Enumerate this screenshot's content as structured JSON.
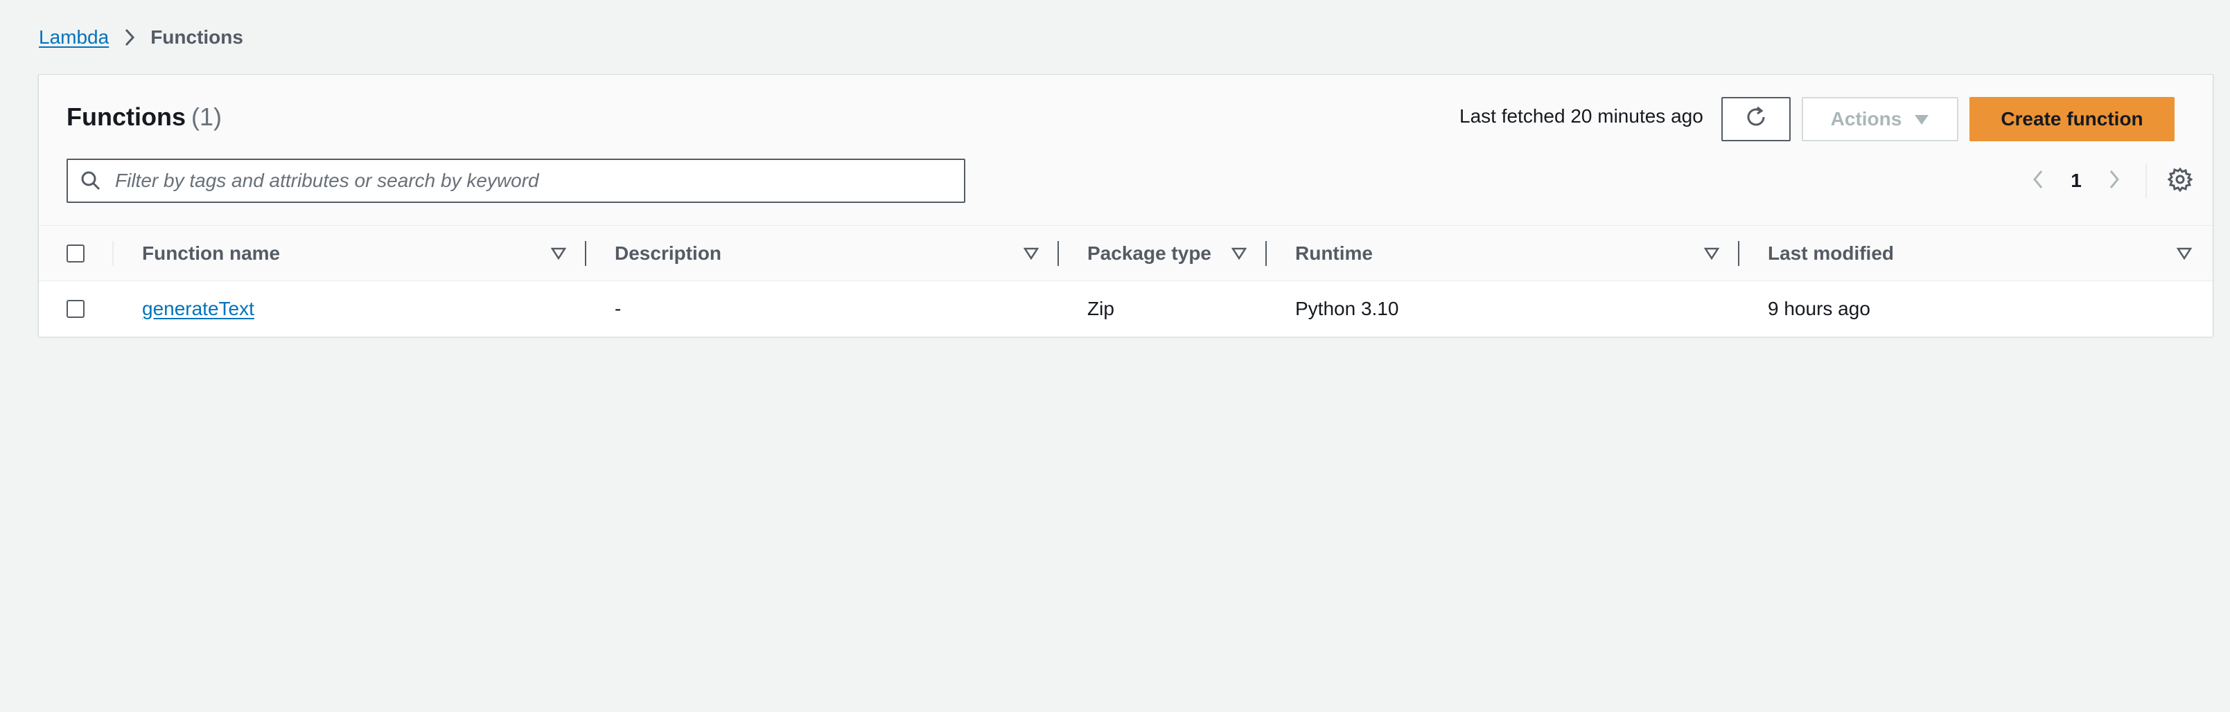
{
  "breadcrumb": {
    "root": "Lambda",
    "current": "Functions"
  },
  "panel": {
    "title": "Functions",
    "count": "(1)",
    "last_fetched": "Last fetched 20 minutes ago",
    "actions_label": "Actions",
    "create_label": "Create function"
  },
  "search": {
    "placeholder": "Filter by tags and attributes or search by keyword",
    "value": ""
  },
  "pagination": {
    "current_page": "1"
  },
  "table": {
    "columns": [
      {
        "label": "Function name"
      },
      {
        "label": "Description"
      },
      {
        "label": "Package type"
      },
      {
        "label": "Runtime"
      },
      {
        "label": "Last modified"
      }
    ],
    "rows": [
      {
        "function_name": "generateText",
        "description": "-",
        "package_type": "Zip",
        "runtime": "Python 3.10",
        "last_modified": "9 hours ago"
      }
    ]
  },
  "icons": {
    "breadcrumb_separator": "chevron-right-icon",
    "refresh": "refresh-icon",
    "actions_caret": "caret-down-icon",
    "search": "search-icon",
    "prev": "chevron-left-icon",
    "next": "chevron-right-icon",
    "settings": "gear-icon",
    "sort": "sort-triangle-icon"
  },
  "colors": {
    "accent": "#ec9335",
    "link": "#0073bb",
    "background": "#f2f3f3"
  }
}
